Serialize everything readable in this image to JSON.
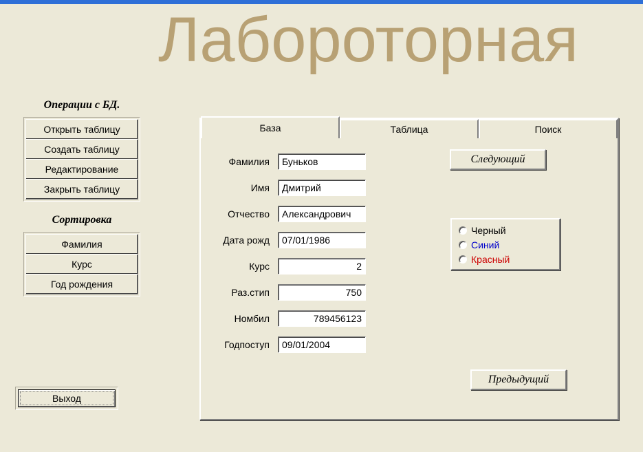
{
  "app_title": "Лабороторная",
  "sidebar": {
    "operations_heading": "Операции с БД.",
    "operations": [
      "Открыть таблицу",
      "Создать таблицу",
      "Редактирование",
      "Закрыть таблицу"
    ],
    "sort_heading": "Сортировка",
    "sort": [
      "Фамилия",
      "Курс",
      "Год рождения"
    ]
  },
  "exit_label": "Выход",
  "tabs": [
    "База",
    "Таблица",
    "Поиск"
  ],
  "active_tab": 0,
  "nav": {
    "next": "Следующий",
    "prev": "Предыдущий"
  },
  "fields": [
    {
      "label": "Фамилия",
      "value": "Буньков",
      "num": false
    },
    {
      "label": "Имя",
      "value": "Дмитрий",
      "num": false
    },
    {
      "label": "Отчество",
      "value": "Александрович",
      "num": false
    },
    {
      "label": "Дата рожд",
      "value": "07/01/1986",
      "num": false
    },
    {
      "label": "Курс",
      "value": "2",
      "num": true
    },
    {
      "label": "Раз.стип",
      "value": "750",
      "num": true
    },
    {
      "label": "Номбил",
      "value": "789456123",
      "num": true
    },
    {
      "label": "Годпоступ",
      "value": "09/01/2004",
      "num": false
    }
  ],
  "colors": [
    {
      "label": "Черный",
      "class": "color-black"
    },
    {
      "label": "Синий",
      "class": "color-blue"
    },
    {
      "label": "Красный",
      "class": "color-red"
    }
  ]
}
